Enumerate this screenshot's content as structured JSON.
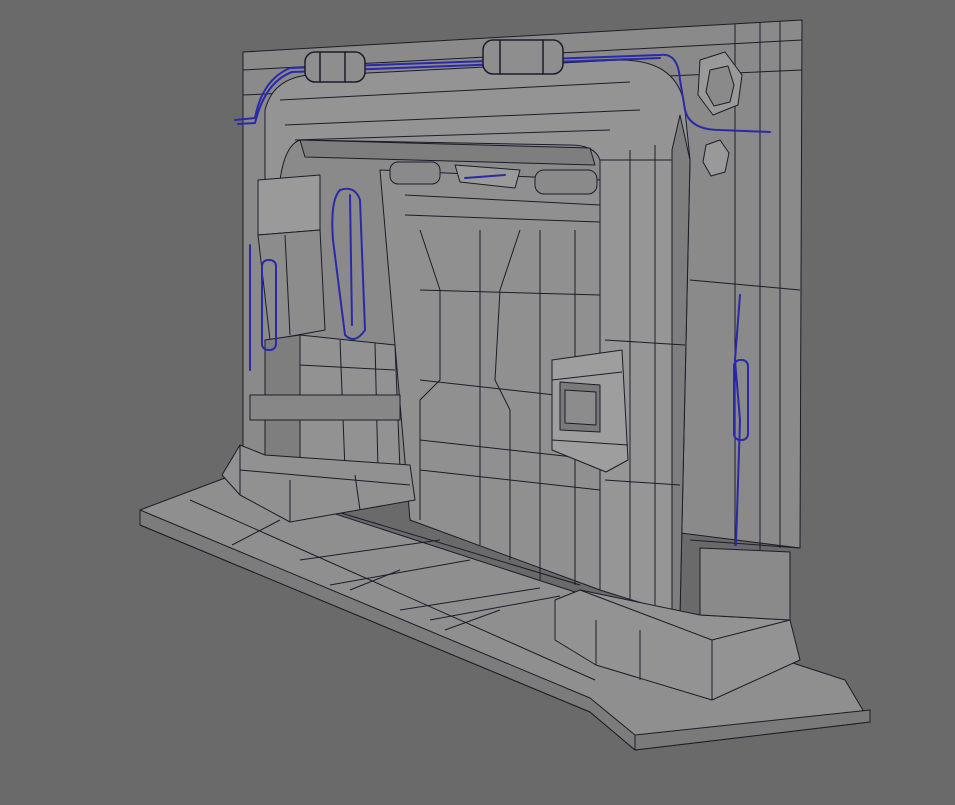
{
  "viewport": {
    "background": "#6a6a6a",
    "colors": {
      "surface": "#8e8e8e",
      "surface_light": "#9c9c9c",
      "surface_dark": "#7c7c7c",
      "wire": "#1c1c2a",
      "selected_wire": "#2a2aa8"
    },
    "icons": [
      "door-frame-model",
      "pipe-wireframe",
      "wall-panel-screen"
    ]
  }
}
